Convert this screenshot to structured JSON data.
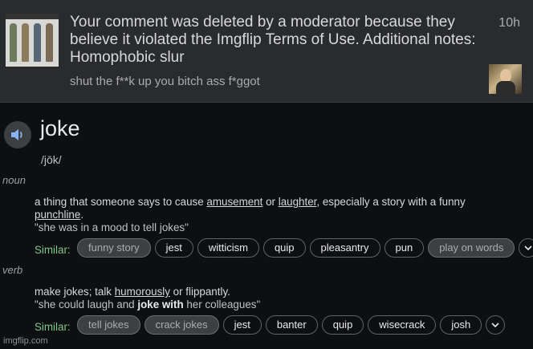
{
  "notification": {
    "message": "Your comment was deleted by a moderator because they believe it violated the Imgflip Terms of Use. Additional notes: Homophobic slur",
    "comment": "shut the f**k up you bitch ass f*ggot",
    "time": "10h"
  },
  "dictionary": {
    "word": "joke",
    "phonetic": "/jōk/",
    "senses": [
      {
        "pos": "noun",
        "def_parts": [
          "a thing that someone says to cause ",
          "amusement",
          " or ",
          "laughter",
          ", especially a story with a funny ",
          "punchline",
          "."
        ],
        "example": "\"she was in a mood to tell jokes\"",
        "similar_label": "Similar:",
        "similar": [
          "funny story",
          "jest",
          "witticism",
          "quip",
          "pleasantry",
          "pun",
          "play on words"
        ]
      },
      {
        "pos": "verb",
        "def_parts": [
          "make jokes; talk ",
          "humorously",
          " or flippantly."
        ],
        "example_parts": [
          "\"she could laugh and ",
          "joke with",
          " her colleagues\""
        ],
        "similar_label": "Similar:",
        "similar": [
          "tell jokes",
          "crack jokes",
          "jest",
          "banter",
          "quip",
          "wisecrack",
          "josh"
        ]
      }
    ]
  },
  "watermark": "imgflip.com",
  "icons": {
    "speaker": "speaker-icon",
    "chevron": "chevron-down-icon"
  },
  "colors": {
    "similar_label": "#7ec68a",
    "panel_bg": "#2a2b2f",
    "page_bg": "#0e0f11"
  }
}
